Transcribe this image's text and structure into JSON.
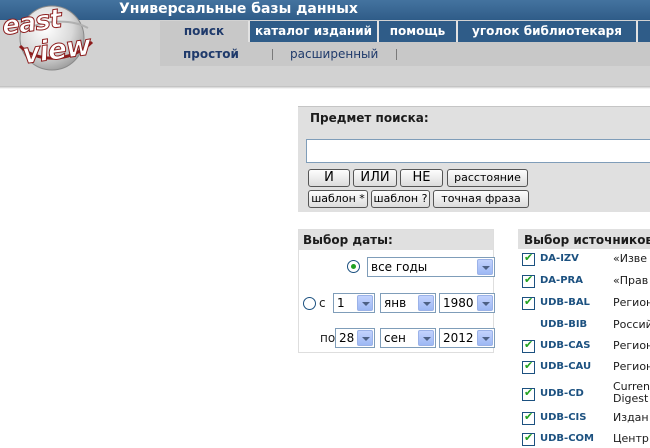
{
  "header": {
    "title": "Универсальные базы данных",
    "logo_text_top": "east",
    "logo_text_bottom": "view"
  },
  "nav": {
    "tabs": [
      {
        "label": "поиск",
        "active": true
      },
      {
        "label": "каталог изданий",
        "active": false
      },
      {
        "label": "помощь",
        "active": false
      },
      {
        "label": "уголок библиотекаря",
        "active": false
      }
    ]
  },
  "subnav": {
    "items": [
      {
        "label": "простой",
        "active": true
      },
      {
        "label": "расширенный",
        "active": false
      }
    ]
  },
  "search": {
    "heading": "Предмет поиска:",
    "input_value": "",
    "operators": [
      "И",
      "ИЛИ",
      "НЕ",
      "расстояние"
    ],
    "templates": [
      "шаблон *",
      "шаблон ?",
      "точная фраза"
    ]
  },
  "date": {
    "heading": "Выбор даты:",
    "all_years": "все годы",
    "from_label": "с",
    "to_label": "по",
    "from": {
      "day": "1",
      "month": "янв",
      "year": "1980"
    },
    "to": {
      "day": "28",
      "month": "сен",
      "year": "2012"
    }
  },
  "sources": {
    "heading": "Выбор источников",
    "items": [
      {
        "code": "DA-IZV",
        "desc": "«Изве",
        "checked": true
      },
      {
        "code": "DA-PRA",
        "desc": "«Прав",
        "checked": true
      },
      {
        "code": "UDB-BAL",
        "desc": "Регион",
        "checked": true
      },
      {
        "code": "UDB-BIB",
        "desc": "Россий",
        "checked": false
      },
      {
        "code": "UDB-CAS",
        "desc": "Регион",
        "checked": true
      },
      {
        "code": "UDB-CAU",
        "desc": "Регион",
        "checked": true
      },
      {
        "code": "UDB-CD",
        "desc": "Curren",
        "desc2": "Digest",
        "checked": true
      },
      {
        "code": "UDB-CIS",
        "desc": "Издан",
        "checked": true
      },
      {
        "code": "UDB-COM",
        "desc": "Центр",
        "checked": true
      }
    ]
  },
  "colors": {
    "header_blue": "#2f5c88",
    "tab_active_text": "#1f3a6b",
    "panel_gray": "#e0e0e0",
    "check_green": "#21a121"
  }
}
